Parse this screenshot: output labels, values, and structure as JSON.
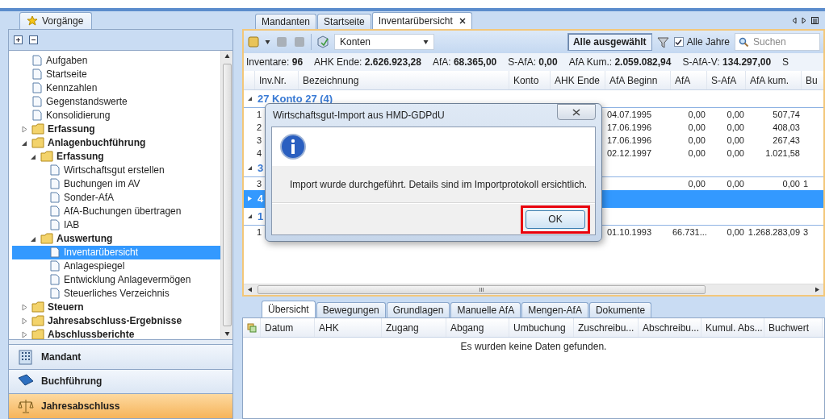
{
  "sidebar": {
    "tab": "Vorgänge",
    "tree": [
      {
        "label": "Aufgaben",
        "kind": "page",
        "selected": false
      },
      {
        "label": "Startseite",
        "kind": "page",
        "selected": false
      },
      {
        "label": "Kennzahlen",
        "kind": "page",
        "selected": false
      },
      {
        "label": "Gegenstandswerte",
        "kind": "page",
        "selected": false
      },
      {
        "label": "Konsolidierung",
        "kind": "page",
        "selected": false
      },
      {
        "label": "Erfassung",
        "kind": "folder",
        "selected": false,
        "expanded": false
      },
      {
        "label": "Anlagenbuchführung",
        "kind": "folder",
        "selected": false,
        "expanded": true,
        "children": [
          {
            "label": "Erfassung",
            "kind": "folder",
            "selected": false,
            "expanded": true,
            "children": [
              {
                "label": "Wirtschaftsgut erstellen",
                "kind": "page",
                "selected": false
              },
              {
                "label": "Buchungen im AV",
                "kind": "page",
                "selected": false
              },
              {
                "label": "Sonder-AfA",
                "kind": "page",
                "selected": false
              },
              {
                "label": "AfA-Buchungen übertragen",
                "kind": "page",
                "selected": false
              },
              {
                "label": "IAB",
                "kind": "page",
                "selected": false
              }
            ]
          },
          {
            "label": "Auswertung",
            "kind": "folder",
            "selected": false,
            "expanded": true,
            "children": [
              {
                "label": "Inventarübersicht",
                "kind": "page",
                "selected": true
              },
              {
                "label": "Anlagespiegel",
                "kind": "page",
                "selected": false
              },
              {
                "label": "Entwicklung Anlagevermögen",
                "kind": "page",
                "selected": false
              },
              {
                "label": "Steuerliches Verzeichnis",
                "kind": "page",
                "selected": false
              }
            ]
          }
        ]
      },
      {
        "label": "Steuern",
        "kind": "folder",
        "selected": false,
        "expanded": false
      },
      {
        "label": "Jahresabschluss-Ergebnisse",
        "kind": "folder",
        "selected": false,
        "expanded": false
      },
      {
        "label": "Abschlussberichte",
        "kind": "folder",
        "selected": false,
        "expanded": false
      }
    ],
    "nav": [
      {
        "label": "Mandant",
        "selected": false
      },
      {
        "label": "Buchführung",
        "selected": false
      },
      {
        "label": "Jahresabschluss",
        "selected": true
      }
    ]
  },
  "main": {
    "tabs": [
      {
        "label": "Mandanten",
        "selected": false,
        "closable": false
      },
      {
        "label": "Startseite",
        "selected": false,
        "closable": false
      },
      {
        "label": "Inventarübersicht",
        "selected": true,
        "closable": true
      }
    ],
    "toolbar": {
      "view": "Konten",
      "filter": "Alle ausgewählt",
      "all_years": {
        "label": "Alle Jahre",
        "checked": true
      },
      "search": {
        "placeholder": "Suchen"
      }
    },
    "summary": [
      {
        "label": "Inventare:",
        "value": "96"
      },
      {
        "label": "AHK Ende:",
        "value": "2.626.923,28"
      },
      {
        "label": "AfA:",
        "value": "68.365,00"
      },
      {
        "label": "S-AfA:",
        "value": "0,00"
      },
      {
        "label": "AfA Kum.:",
        "value": "2.059.082,94"
      },
      {
        "label": "S-AfA-V:",
        "value": "134.297,00"
      },
      {
        "label": "S"
      }
    ],
    "table": {
      "columns": [
        "Inv.Nr.",
        "Bezeichnung",
        "Konto",
        "AHK Ende",
        "AfA Beginn",
        "AfA",
        "S-AfA",
        "AfA kum.",
        "Bu"
      ],
      "rows": [
        {
          "kind": "group",
          "label": "27 Konto 27 (4)",
          "expanded": true,
          "selected": false
        },
        {
          "kind": "item",
          "selected": false,
          "cells": [
            "1",
            null,
            null,
            null,
            "04.07.1995",
            "0,00",
            "0,00",
            "507,74",
            null
          ]
        },
        {
          "kind": "item",
          "selected": false,
          "cells": [
            "2",
            null,
            null,
            null,
            "17.06.1996",
            "0,00",
            "0,00",
            "408,03",
            null
          ]
        },
        {
          "kind": "item",
          "selected": false,
          "cells": [
            "3",
            null,
            null,
            null,
            "17.06.1996",
            "0,00",
            "0,00",
            "267,43",
            null
          ]
        },
        {
          "kind": "item",
          "selected": false,
          "cells": [
            "4",
            null,
            null,
            null,
            "02.12.1997",
            "0,00",
            "0,00",
            "1.021,58",
            null
          ]
        },
        {
          "kind": "group",
          "label": "3",
          "expanded": true,
          "selected": false
        },
        {
          "kind": "item",
          "selected": false,
          "cells": [
            "3",
            null,
            null,
            null,
            null,
            "0,00",
            "0,00",
            "0,00",
            "1"
          ]
        },
        {
          "kind": "group",
          "label": "4",
          "expanded": false,
          "selected": true
        },
        {
          "kind": "group",
          "label": "1",
          "expanded": true,
          "selected": false
        },
        {
          "kind": "item",
          "selected": false,
          "cells": [
            "1",
            null,
            null,
            null,
            "01.10.1993",
            "66.731...",
            "0,00",
            "1.268.283,09",
            "3"
          ]
        }
      ]
    },
    "scrollbar_grip": "III",
    "detail_tabs": [
      {
        "label": "Übersicht",
        "selected": true
      },
      {
        "label": "Bewegungen",
        "selected": false
      },
      {
        "label": "Grundlagen",
        "selected": false
      },
      {
        "label": "Manuelle AfA",
        "selected": false
      },
      {
        "label": "Mengen-AfA",
        "selected": false
      },
      {
        "label": "Dokumente",
        "selected": false
      }
    ],
    "detail_columns": [
      "Datum",
      "AHK",
      "Zugang",
      "Abgang",
      "Umbuchung",
      "Zuschreibu...",
      "Abschreibu...",
      "Kumul. Abs...",
      "Buchwert"
    ],
    "empty_message": "Es wurden keine Daten gefunden."
  },
  "dialog": {
    "title": "Wirtschaftsgut-Import aus HMD-GDPdU",
    "message": "Import wurde durchgeführt. Details sind im Importprotokoll ersichtlich.",
    "button": {
      "label": "OK",
      "highlighted": true
    }
  }
}
